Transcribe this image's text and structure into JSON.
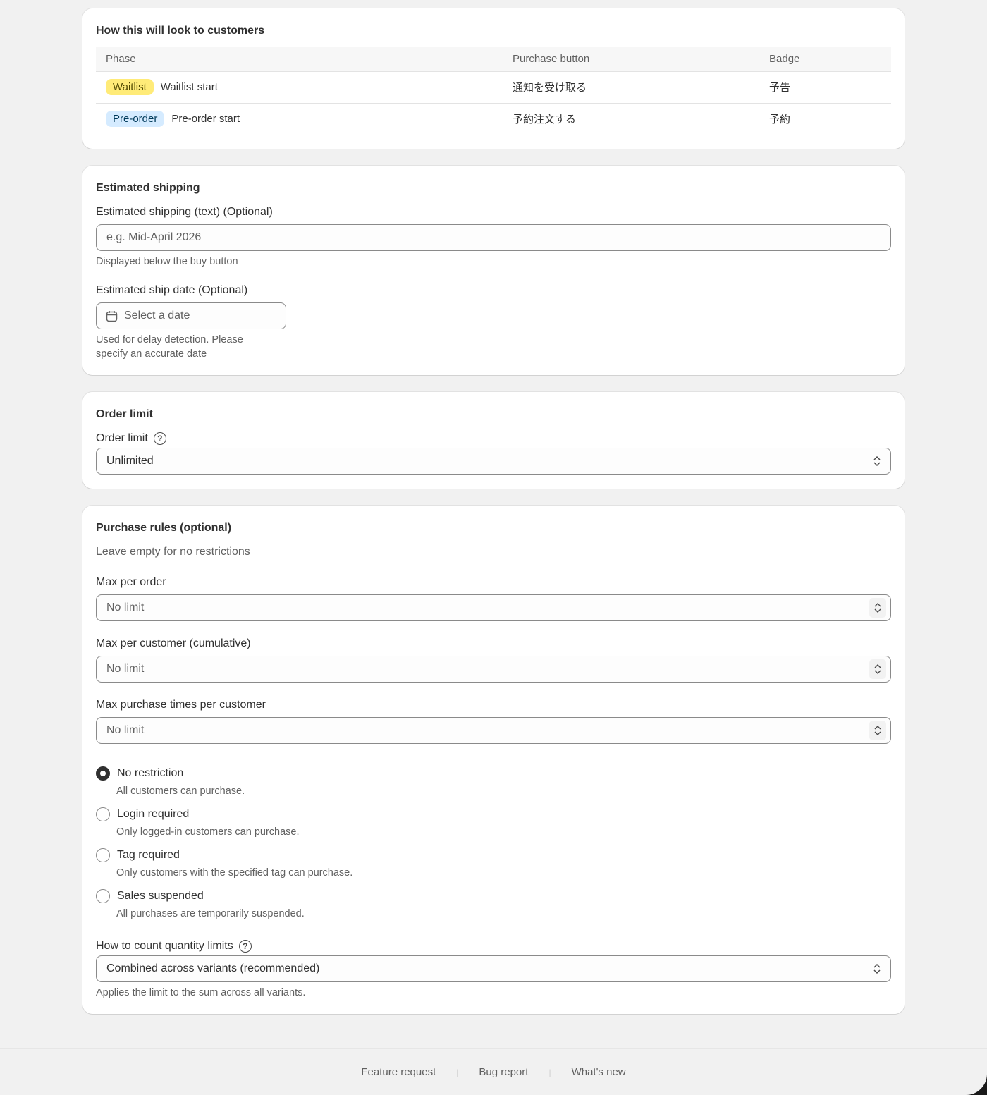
{
  "preview": {
    "title": "How this will look to customers",
    "columns": [
      "Phase",
      "Purchase button",
      "Badge"
    ],
    "rows": [
      {
        "badge": "Waitlist",
        "phase": "Waitlist start",
        "button": "通知を受け取る",
        "tag": "予告",
        "badge_color": "#ffeb78"
      },
      {
        "badge": "Pre-order",
        "phase": "Pre-order start",
        "button": "予約注文する",
        "tag": "予約",
        "badge_color": "#d5ebff"
      }
    ]
  },
  "shipping": {
    "title": "Estimated shipping",
    "text_label": "Estimated shipping (text) (Optional)",
    "text_placeholder": "e.g. Mid-April 2026",
    "text_help": "Displayed below the buy button",
    "date_label": "Estimated ship date (Optional)",
    "date_placeholder": "Select a date",
    "date_help_1": "Used for delay detection. Please",
    "date_help_2": "specify an accurate date"
  },
  "order_limit": {
    "title": "Order limit",
    "label": "Order limit",
    "value": "Unlimited"
  },
  "rules": {
    "title": "Purchase rules (optional)",
    "subtitle": "Leave empty for no restrictions",
    "max_order_label": "Max per order",
    "max_customer_label": "Max per customer (cumulative)",
    "max_times_label": "Max purchase times per customer",
    "no_limit": "No limit",
    "options": [
      {
        "label": "No restriction",
        "desc": "All customers can purchase.",
        "selected": true
      },
      {
        "label": "Login required",
        "desc": "Only logged-in customers can purchase.",
        "selected": false
      },
      {
        "label": "Tag required",
        "desc": "Only customers with the specified tag can purchase.",
        "selected": false
      },
      {
        "label": "Sales suspended",
        "desc": "All purchases are temporarily suspended.",
        "selected": false
      }
    ],
    "count_label": "How to count quantity limits",
    "count_value": "Combined across variants (recommended)",
    "count_help": "Applies the limit to the sum across all variants."
  },
  "footer": {
    "links": [
      "Feature request",
      "Bug report",
      "What's new"
    ],
    "separator": "|"
  }
}
